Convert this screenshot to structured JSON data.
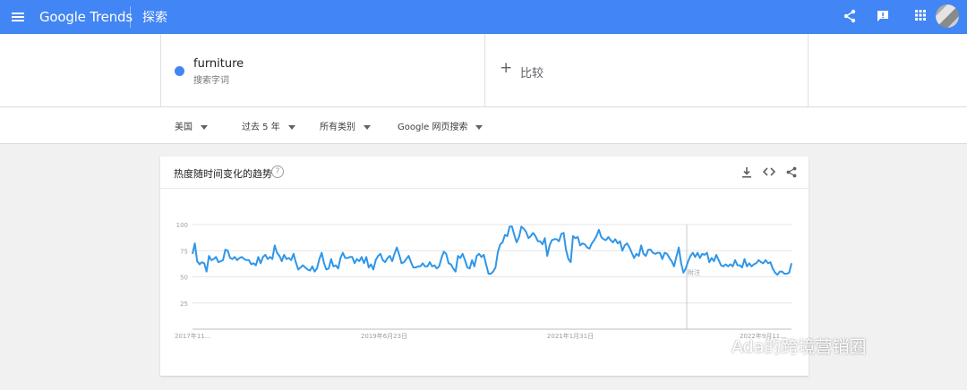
{
  "topbar": {
    "logo": "Google Trends",
    "page_title": "探索",
    "icons": [
      "menu-icon",
      "share-icon",
      "feedback-icon",
      "apps-icon",
      "avatar"
    ],
    "color": "#4285f4"
  },
  "search_term": {
    "name": "furniture",
    "type": "搜索字词",
    "color": "#4285f4"
  },
  "compare": {
    "label": "比较"
  },
  "filters": [
    {
      "label": "美国"
    },
    {
      "label": "过去 5 年"
    },
    {
      "label": "所有类别"
    },
    {
      "label": "Google 网页搜索"
    }
  ],
  "card": {
    "title": "热度随时间变化的趋势",
    "icons": [
      "download-icon",
      "embed-icon",
      "share-icon"
    ]
  },
  "chart_data": {
    "type": "line",
    "series": [
      {
        "name": "furniture",
        "color": "#4285f4",
        "values": [
          72,
          82,
          65,
          62,
          64,
          63,
          55,
          70,
          66,
          67,
          69,
          64,
          65,
          66,
          76,
          75,
          68,
          67,
          69,
          66,
          68,
          69,
          67,
          66,
          66,
          62,
          63,
          61,
          69,
          63,
          69,
          71,
          67,
          69,
          67,
          80,
          73,
          70,
          65,
          71,
          67,
          68,
          66,
          72,
          64,
          57,
          59,
          61,
          59,
          57,
          56,
          60,
          55,
          58,
          67,
          73,
          63,
          57,
          58,
          67,
          60,
          61,
          58,
          68,
          73,
          68,
          68,
          69,
          69,
          63,
          67,
          65,
          69,
          63,
          69,
          59,
          62,
          57,
          66,
          70,
          72,
          66,
          64,
          68,
          70,
          65,
          72,
          78,
          71,
          63,
          64,
          67,
          70,
          64,
          59,
          59,
          60,
          60,
          63,
          60,
          60,
          64,
          60,
          61,
          58,
          60,
          68,
          74,
          72,
          63,
          62,
          58,
          55,
          70,
          68,
          72,
          66,
          59,
          58,
          66,
          60,
          70,
          72,
          69,
          71,
          62,
          53,
          53,
          55,
          59,
          74,
          81,
          83,
          90,
          89,
          98,
          98,
          90,
          83,
          88,
          98,
          96,
          93,
          87,
          89,
          92,
          89,
          84,
          84,
          81,
          87,
          70,
          80,
          85,
          86,
          86,
          84,
          91,
          92,
          76,
          67,
          64,
          89,
          87,
          88,
          80,
          82,
          81,
          78,
          77,
          82,
          85,
          89,
          95,
          88,
          86,
          85,
          88,
          85,
          83,
          86,
          82,
          84,
          75,
          80,
          82,
          78,
          73,
          68,
          72,
          70,
          80,
          72,
          70,
          76,
          76,
          73,
          72,
          73,
          73,
          67,
          73,
          72,
          68,
          65,
          60,
          69,
          78,
          63,
          54,
          58,
          65,
          70,
          73,
          69,
          73,
          68,
          72,
          71,
          73,
          64,
          68,
          65,
          71,
          66,
          61,
          60,
          62,
          60,
          62,
          60,
          66,
          61,
          61,
          59,
          67,
          60,
          63,
          60,
          62,
          63,
          66,
          64,
          63,
          66,
          63,
          64,
          58,
          54,
          52,
          55,
          55,
          53,
          53,
          54,
          63
        ]
      }
    ],
    "x_tick_labels": [
      "2017年11...",
      "2019年6月23日",
      "2021年1月31日",
      "2022年9月11..."
    ],
    "y_tick_labels": [
      "100",
      "75",
      "50",
      "25"
    ],
    "ylim": [
      0,
      100
    ],
    "annotation": "附注",
    "grid": true
  },
  "watermark": {
    "text": "Ada的跨境营销圈"
  }
}
